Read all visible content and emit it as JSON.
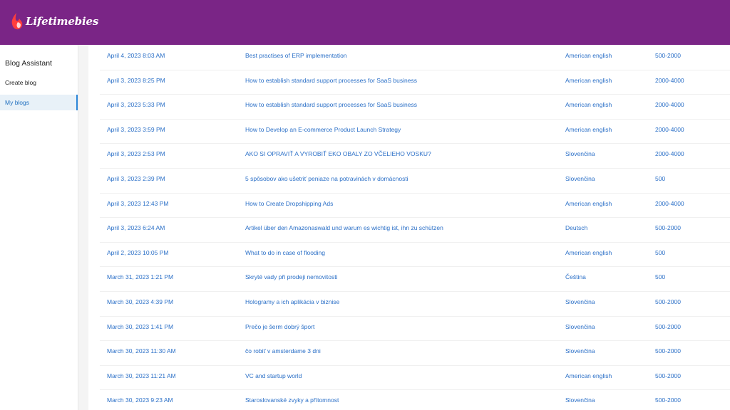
{
  "header": {
    "brand": "Lifetimebies",
    "accent_color": "#7a2586"
  },
  "sidebar": {
    "title": "Blog Assistant",
    "items": [
      {
        "label": "Create blog"
      },
      {
        "label": "My blogs"
      }
    ]
  },
  "blogs": [
    {
      "date": "April 4, 2023 8:03 AM",
      "title": "Best practises of ERP implementation",
      "language": "American english",
      "words": "500-2000"
    },
    {
      "date": "April 3, 2023 8:25 PM",
      "title": "How to establish standard support processes for SaaS business",
      "language": "American english",
      "words": "2000-4000"
    },
    {
      "date": "April 3, 2023 5:33 PM",
      "title": "How to establish standard support processes for SaaS business",
      "language": "American english",
      "words": "2000-4000"
    },
    {
      "date": "April 3, 2023 3:59 PM",
      "title": "How to Develop an E-commerce Product Launch Strategy",
      "language": "American english",
      "words": "2000-4000"
    },
    {
      "date": "April 3, 2023 2:53 PM",
      "title": "AKO SI OPRAVIŤ A VYROBIŤ EKO OBALY ZO VČELIEHO VOSKU?",
      "language": "Slovenčina",
      "words": "2000-4000"
    },
    {
      "date": "April 3, 2023 2:39 PM",
      "title": "5 spôsobov ako ušetriť peniaze na potravinách v domácnosti",
      "language": "Slovenčina",
      "words": "500"
    },
    {
      "date": "April 3, 2023 12:43 PM",
      "title": "How to Create Dropshipping Ads",
      "language": "American english",
      "words": "2000-4000"
    },
    {
      "date": "April 3, 2023 6:24 AM",
      "title": "Artikel über den Amazonaswald und warum es wichtig ist, ihn zu schützen",
      "language": "Deutsch",
      "words": "500-2000"
    },
    {
      "date": "April 2, 2023 10:05 PM",
      "title": "What to do in case of flooding",
      "language": "American english",
      "words": "500"
    },
    {
      "date": "March 31, 2023 1:21 PM",
      "title": "Skryté vady při prodeji nemovitosti",
      "language": "Čeština",
      "words": "500"
    },
    {
      "date": "March 30, 2023 4:39 PM",
      "title": "Hologramy a ich aplikácia v biznise",
      "language": "Slovenčina",
      "words": "500-2000"
    },
    {
      "date": "March 30, 2023 1:41 PM",
      "title": "Prečo je šerm dobrý šport",
      "language": "Slovenčina",
      "words": "500-2000"
    },
    {
      "date": "March 30, 2023 11:30 AM",
      "title": "čo robiť v amsterdame 3 dni",
      "language": "Slovenčina",
      "words": "500-2000"
    },
    {
      "date": "March 30, 2023 11:21 AM",
      "title": "VC and startup world",
      "language": "American english",
      "words": "500-2000"
    },
    {
      "date": "March 30, 2023 9:23 AM",
      "title": "Staroslovanské zvyky a přítomnost",
      "language": "Slovenčina",
      "words": "500-2000"
    }
  ]
}
